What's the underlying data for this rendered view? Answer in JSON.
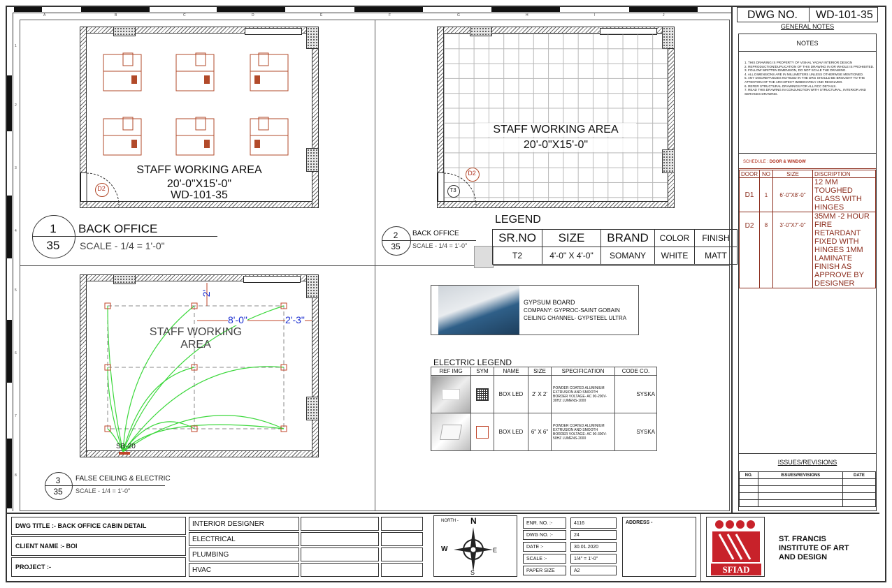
{
  "grid": {
    "cols": [
      "A",
      "B",
      "C",
      "D",
      "E",
      "F",
      "G",
      "H",
      "I",
      "J"
    ],
    "rows": [
      "1",
      "2",
      "3",
      "4",
      "5",
      "6",
      "7",
      "8"
    ]
  },
  "dwg": {
    "label": "DWG NO.",
    "value": "WD-101-35"
  },
  "general_notes_title": "GENERAL NOTES",
  "notes_title": "NOTES",
  "notes": [
    "1.   THIS DRAWING IS PROPERTY OF VISHAL YADAV INTERIOR DESIGN",
    "2.   REPRODUCTION/DUPLICATION OF THIS DRAWING IN OR WHOLE IS PROHIBITED.",
    "3.   FOLLOW WRITTEN DIMENSION, DO NOT SCALE THE DRAWING.",
    "4.   ALL DIMENSIONS ARE IN MILLIMETERS UNLESS OTHERWISE MENTIONED.",
    "5.   ANY DISCREPANCIES NOTICED IN THE DRG SHOULD BE BROUGHT TO THE ATTENTION OF THE ARCHITECT IMMEDIATELY AND RESOLVED.",
    "6.   REFER STRUCTURAL DRAWINGS FOR ALL RCC DETAILS.",
    "7.   READ THIS DRAWING IN CONJUNCTION WITH STRUCTURAL, INTERIOR AND SERVICES DRAWING."
  ],
  "schedule": {
    "prefix": "SCHEDULE :",
    "title": "DOOR & WINDOW",
    "headers": [
      "DOOR",
      "NO",
      "SIZE",
      "DISCRIPTION"
    ],
    "rows": [
      {
        "door": "D1",
        "no": "1",
        "size": "6'-0\"X8'-0\"",
        "desc": "12 MM TOUGHED GLASS WITH HINGES"
      },
      {
        "door": "D2",
        "no": "8",
        "size": "3'-0\"X7'-0\"",
        "desc": "35MM -2 HOUR FIRE RETARDANT FIXED WITH HINGES 1MM LAMINATE FINISH AS APPROVE BY DESIGNER"
      }
    ]
  },
  "issues": {
    "title": "ISSUES/REVISIONS",
    "headers": [
      "NO.",
      "ISSUES/REVISIONS",
      "DATE"
    ]
  },
  "plan1": {
    "room": "STAFF WORKING AREA",
    "dim": "20'-0\"X15'-0\"",
    "ref": "WD-101-35",
    "num": "1",
    "scale_den": "35",
    "title": "BACK OFFICE",
    "scale": "SCALE - 1/4 = 1'-0\"",
    "door": "D2"
  },
  "plan2": {
    "room": "STAFF WORKING AREA",
    "dim": "20'-0\"X15'-0\"",
    "num": "2",
    "scale_den": "35",
    "title": "BACK OFFICE",
    "scale": "SCALE - 1/4 = 1'-0\"",
    "door": "D2",
    "tile": "T3"
  },
  "plan3": {
    "room1": "STAFF WORKING",
    "room2": "AREA",
    "num": "3",
    "scale_den": "35",
    "title": "FALSE CEILING & ELECTRIC",
    "scale": "SCALE - 1/4 = 1'-0\"",
    "dim_a": "2'",
    "dim_b": "8'-0\"",
    "dim_c": "2'-3\"",
    "switch": "SB-20"
  },
  "legend": {
    "title": "LEGEND",
    "headers": [
      "SR.NO",
      "SIZE",
      "BRAND",
      "COLOR",
      "FINISH"
    ],
    "row": [
      "T2",
      "4'-0\" X 4'-0\"",
      "SOMANY",
      "WHITE",
      "MATT"
    ]
  },
  "gypsum": {
    "line1": "GYPSUM BOARD",
    "line2": "COMPANY: GYPROC-SAINT GOBAIN",
    "line3": "CEILING CHANNEL- GYPSTEEL ULTRA"
  },
  "electric": {
    "title": "ELECTRIC LEGEND",
    "headers": [
      "REF IMG",
      "SYM",
      "NAME",
      "SIZE",
      "SPECIFICATION",
      "CODE  CO."
    ],
    "rows": [
      {
        "name": "BOX LED",
        "size": "2' X 2'",
        "spec": "POWDER COATED ALUMINIUM EXTRUSION AND SMOOTH BORDER VOLTAGE- AC 90-200V-30HZ LUMENS-1000",
        "co": "SYSKA"
      },
      {
        "name": "BOX LED",
        "size": "6\" X 6\"",
        "spec": "POWDER COATED ALUMINIUM EXTRUSION AND SMOOTH BORDER VOLTAGE- AC 90-300V-50HZ LUMENS-2000",
        "co": "SYSKA"
      }
    ]
  },
  "titleblock": {
    "dwg_title": "DWG TITLE :- BACK OFFICE CABIN DETAIL",
    "client": "CLIENT NAME :- BOI",
    "project": "PROJECT :-",
    "disciplines": [
      "INTERIOR DESIGNER",
      "ELECTRICAL",
      "PLUMBING",
      "HVAC"
    ],
    "north": "NORTH -",
    "compass": {
      "n": "N",
      "s": "S",
      "e": "E",
      "w": "W"
    },
    "fields": [
      {
        "label": "ENR. NO. :-",
        "value": "4116"
      },
      {
        "label": "DWG NO. :-",
        "value": "24"
      },
      {
        "label": "DATE :-",
        "value": "30.01.2020"
      },
      {
        "label": "SCALE :-",
        "value": "1/4\" = 1'-0\""
      },
      {
        "label": "PAPER SIZE",
        "value": "A2"
      }
    ],
    "address": "ADDRESS -",
    "logo_text": "SFIAD",
    "institute": "ST. FRANCIS INSTITUTE OF ART AND DESIGN"
  }
}
